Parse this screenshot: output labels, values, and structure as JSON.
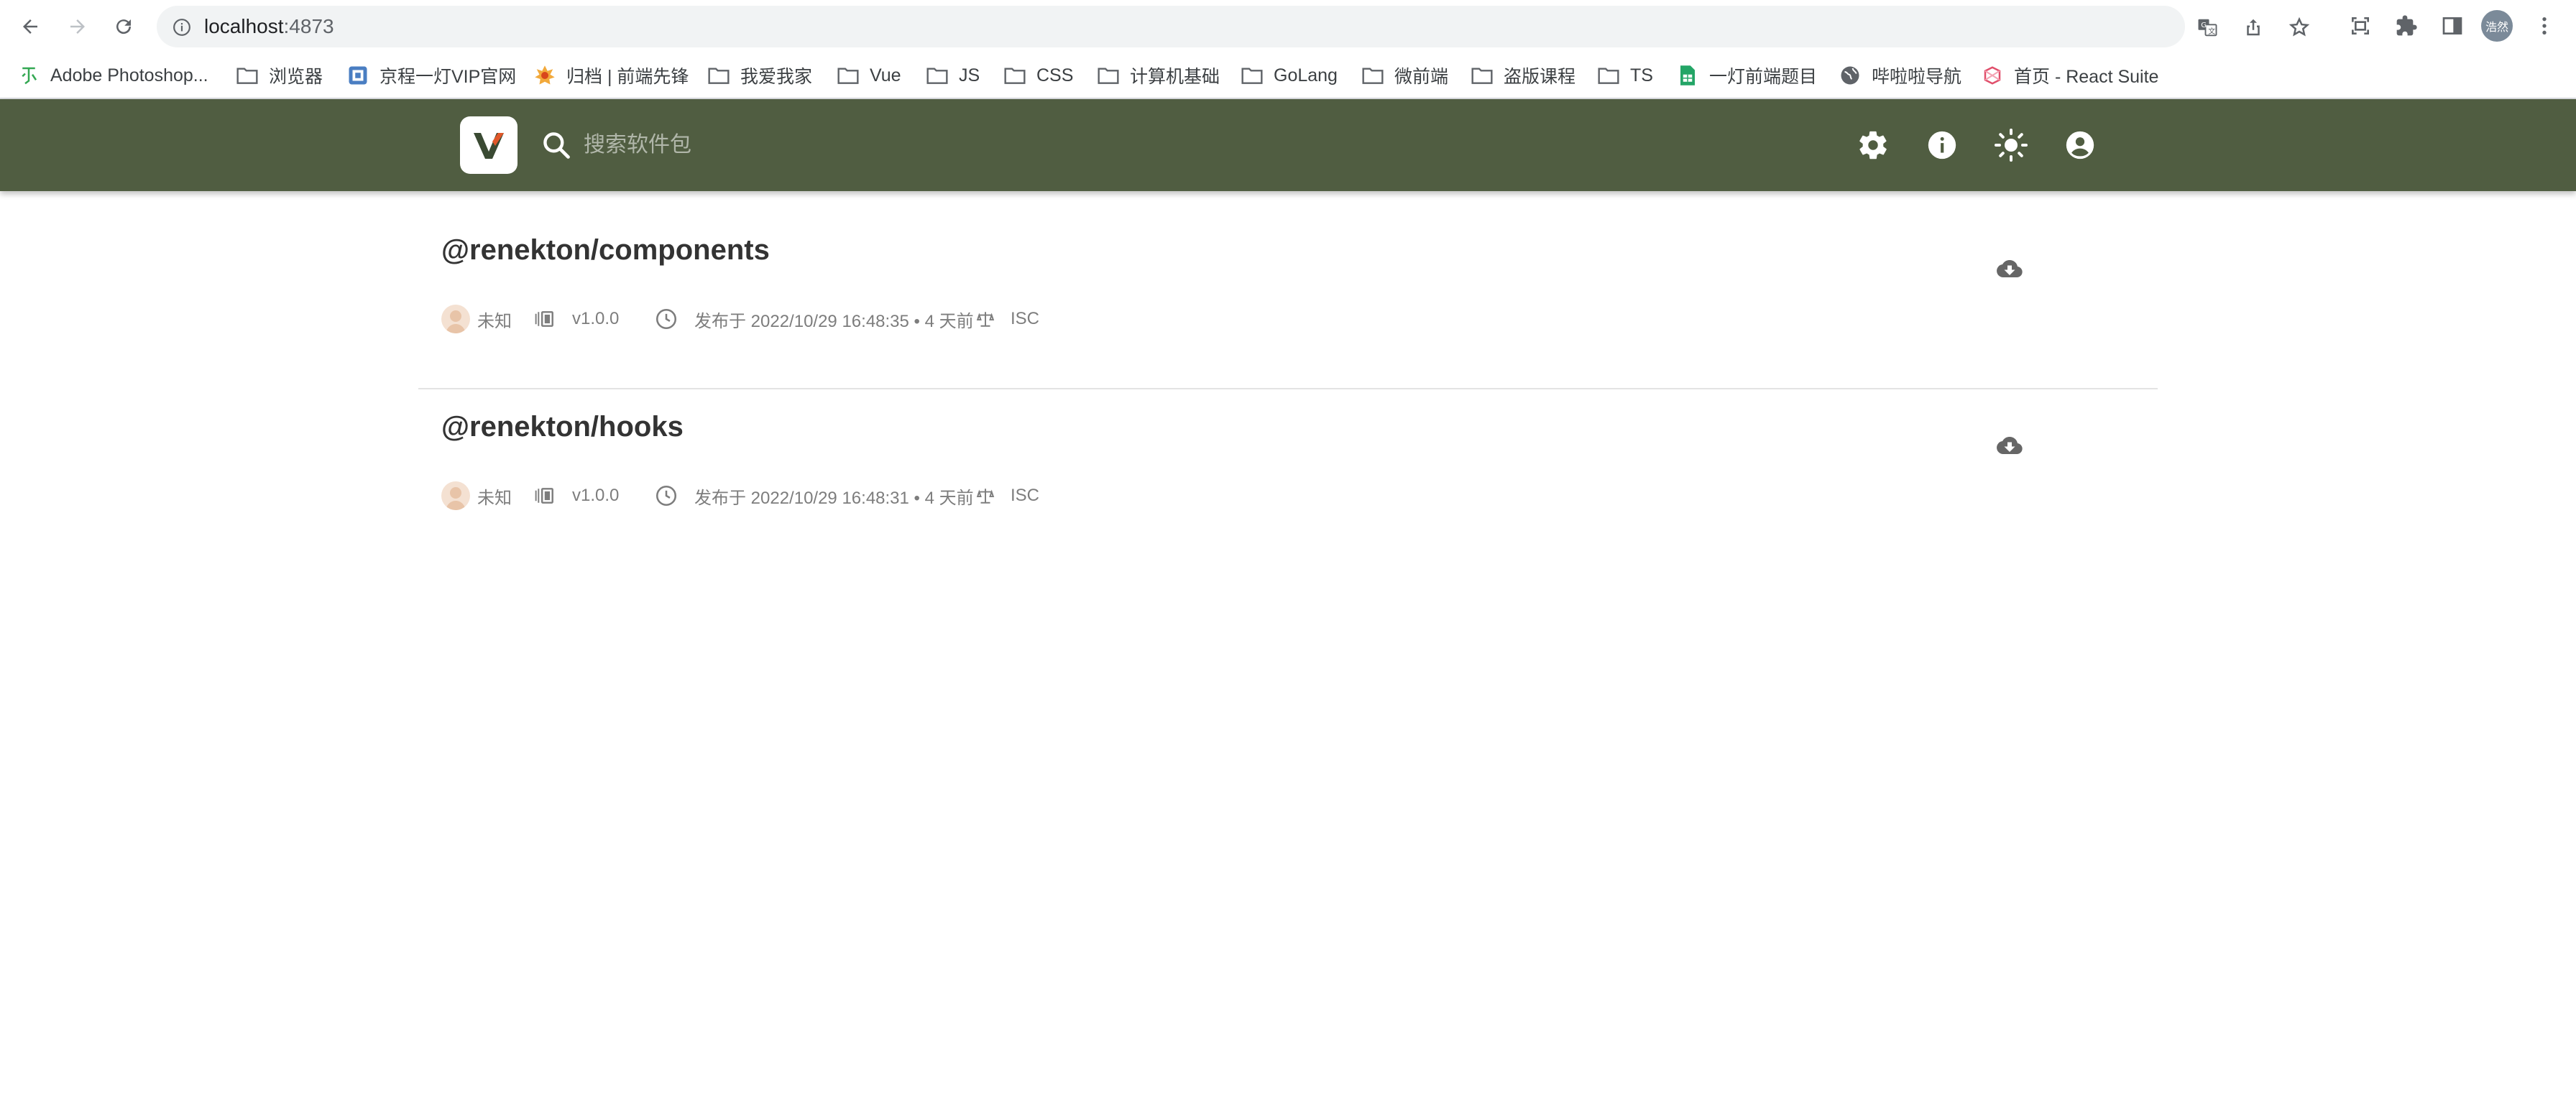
{
  "browser": {
    "url_host": "localhost",
    "url_port": ":4873",
    "profile_label": "浩然",
    "bookmarks": [
      {
        "label": "Adobe Photoshop...",
        "icon": "le-icon"
      },
      {
        "label": "浏览器",
        "icon": "folder-icon"
      },
      {
        "label": "京程一灯VIP官网",
        "icon": "site-icon"
      },
      {
        "label": "归档 | 前端先锋",
        "icon": "site-icon"
      },
      {
        "label": "我爱我家",
        "icon": "folder-icon"
      },
      {
        "label": "Vue",
        "icon": "folder-icon"
      },
      {
        "label": "JS",
        "icon": "folder-icon"
      },
      {
        "label": "CSS",
        "icon": "folder-icon"
      },
      {
        "label": "计算机基础",
        "icon": "folder-icon"
      },
      {
        "label": "GoLang",
        "icon": "folder-icon"
      },
      {
        "label": "微前端",
        "icon": "folder-icon"
      },
      {
        "label": "盗版课程",
        "icon": "folder-icon"
      },
      {
        "label": "TS",
        "icon": "folder-icon"
      },
      {
        "label": "一灯前端题目",
        "icon": "sheet-icon"
      },
      {
        "label": "哔啦啦导航",
        "icon": "globe-icon"
      },
      {
        "label": "首页 - React Suite",
        "icon": "rsuite-icon"
      }
    ]
  },
  "header": {
    "search_placeholder": "搜索软件包",
    "accent": "#505d41"
  },
  "packages": [
    {
      "name": "@renekton/components",
      "author": "未知",
      "version": "v1.0.0",
      "published": "发布于 2022/10/29 16:48:35 • 4 天前",
      "license": "ISC"
    },
    {
      "name": "@renekton/hooks",
      "author": "未知",
      "version": "v1.0.0",
      "published": "发布于 2022/10/29 16:48:31 • 4 天前",
      "license": "ISC"
    }
  ]
}
